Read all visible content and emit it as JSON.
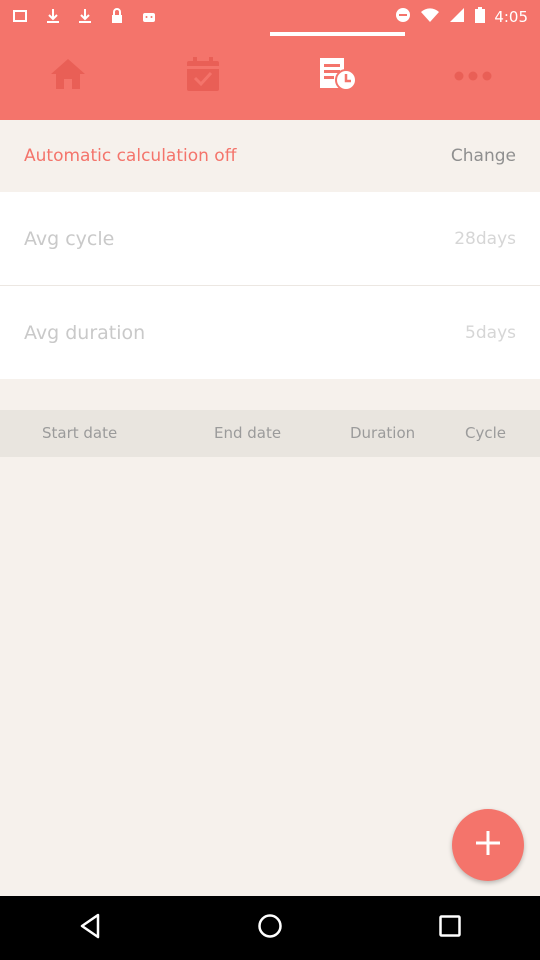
{
  "status_bar": {
    "time": "4:05"
  },
  "nav": {
    "tabs": [
      {
        "name": "home",
        "icon": "home-icon",
        "active": false
      },
      {
        "name": "calendar",
        "icon": "calendar-check-icon",
        "active": false
      },
      {
        "name": "history",
        "icon": "history-list-icon",
        "active": true
      },
      {
        "name": "more",
        "icon": "more-dots-icon",
        "active": false
      }
    ]
  },
  "calculation": {
    "label": "Automatic calculation off",
    "change_label": "Change"
  },
  "avg_cycle": {
    "label": "Avg cycle",
    "value": "28days"
  },
  "avg_duration": {
    "label": "Avg duration",
    "value": "5days"
  },
  "table": {
    "columns": [
      "Start date",
      "End date",
      "Duration",
      "Cycle"
    ]
  },
  "colors": {
    "accent": "#f4746b",
    "background": "#f6f1ec"
  }
}
